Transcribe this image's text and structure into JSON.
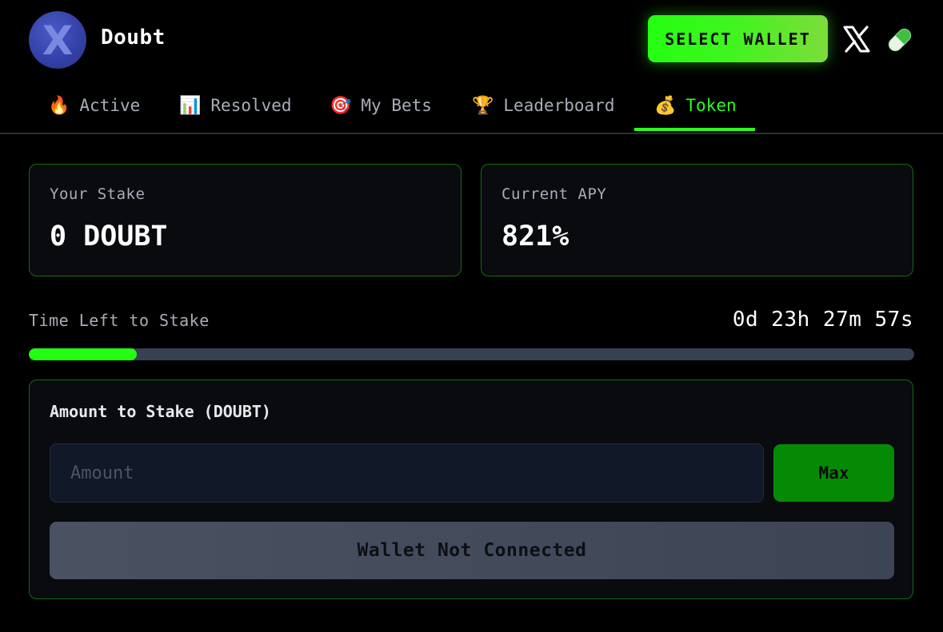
{
  "header": {
    "logo_letter": "X",
    "app_name": "Doubt",
    "select_wallet_label": "SELECT WALLET",
    "icons": [
      "x-icon",
      "pill-icon"
    ]
  },
  "tabs": [
    {
      "emoji": "🔥",
      "label": "Active",
      "active": false
    },
    {
      "emoji": "📊",
      "label": "Resolved",
      "active": false
    },
    {
      "emoji": "🎯",
      "label": "My Bets",
      "active": false
    },
    {
      "emoji": "🏆",
      "label": "Leaderboard",
      "active": false
    },
    {
      "emoji": "💰",
      "label": "Token",
      "active": true
    }
  ],
  "stats": {
    "stake": {
      "label": "Your Stake",
      "value": "0 DOUBT"
    },
    "apy": {
      "label": "Current APY",
      "value": "821%"
    }
  },
  "timer": {
    "label": "Time Left to Stake",
    "value": "0d 23h 27m 57s",
    "progress_fraction": 0.122
  },
  "stake_form": {
    "label": "Amount to Stake (DOUBT)",
    "amount_placeholder": "Amount",
    "amount_value": "",
    "max_label": "Max",
    "submit_label": "Wallet Not Connected"
  },
  "colors": {
    "accent": "#2aff1a",
    "card_border": "#136b13",
    "background": "#000000",
    "muted_text": "#a8adb8",
    "track": "#374151"
  }
}
